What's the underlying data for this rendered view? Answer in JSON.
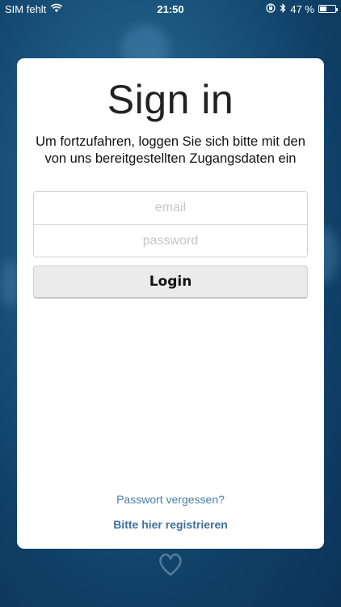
{
  "status_bar": {
    "carrier": "SIM fehlt",
    "time": "21:50",
    "battery_percent": "47 %",
    "battery_level": 0.47,
    "icons": [
      "wifi-icon",
      "rotation-lock-icon",
      "bluetooth-icon",
      "battery-icon"
    ]
  },
  "login": {
    "title": "Sign in",
    "subtitle": "Um fortzufahren, loggen Sie sich bitte mit den von uns bereitgestellten Zugangsdaten ein",
    "email_placeholder": "email",
    "password_placeholder": "password",
    "login_button": "Login",
    "forgot_password_link": "Passwort vergessen?",
    "register_link": "Bitte hier registrieren"
  },
  "colors": {
    "background": "#1c5880",
    "link": "#4a7fab",
    "button_bg": "#ebebeb"
  }
}
